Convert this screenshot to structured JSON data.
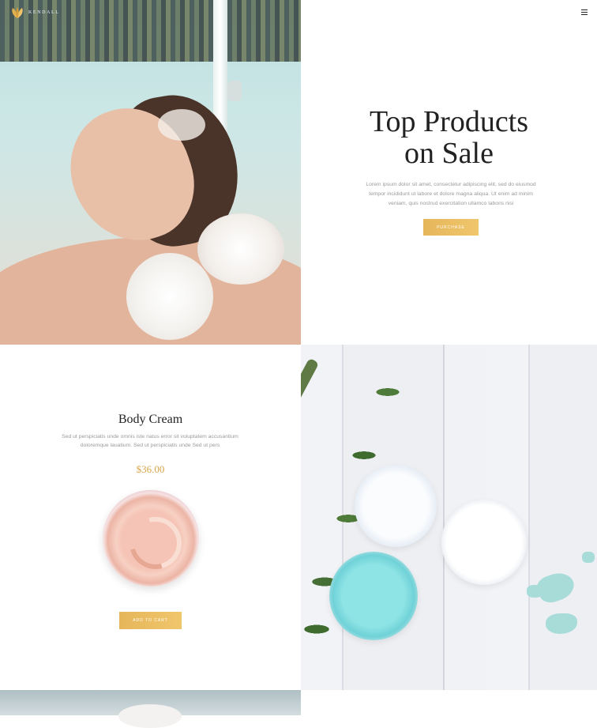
{
  "header": {
    "logo_text": "KENDALL",
    "menu_icon": "hamburger-menu-icon"
  },
  "hero": {
    "title": "Top Products\non Sale",
    "description": "Lorem ipsum dolor sit amet, consectetur adipiscing elit, sed do eiusmod tempor incididunt ut labore et dolore magna aliqua. Ut enim ad minim veniam, quis nostrud exercitation ullamco laboris nisi",
    "button_label": "PURCHASE"
  },
  "product": {
    "title": "Body Cream",
    "description": "Sed ut perspiciatis unde omnis iste natus error sit voluptatem accusantium doloremque lauatium.  Sed ut perspiciatis unde  Sed ut pers",
    "price": "$36.00",
    "button_label": "ADD TO CART"
  },
  "colors": {
    "accent_gold": "#e8b85e",
    "price_gold": "#d9a54b",
    "text_dark": "#222222",
    "text_muted": "#9a9a9a"
  }
}
